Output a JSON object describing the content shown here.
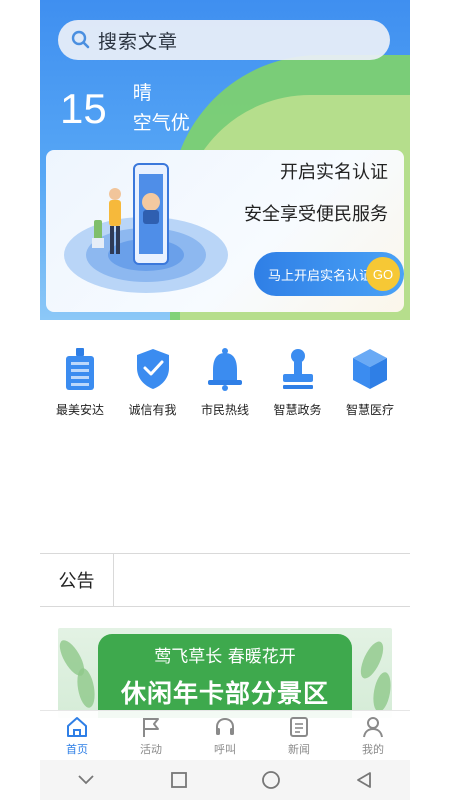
{
  "search": {
    "placeholder": "搜索文章"
  },
  "weather": {
    "temperature": "15",
    "condition": "晴",
    "air_quality": "空气优"
  },
  "verify_card": {
    "line1": "开启实名认证",
    "line2": "安全享受便民服务",
    "button_label": "马上开启实名认证",
    "go_label": "GO"
  },
  "quick_menu": [
    {
      "label": "最美安达",
      "icon": "building-icon"
    },
    {
      "label": "诚信有我",
      "icon": "shield-check-icon"
    },
    {
      "label": "市民热线",
      "icon": "bell-icon"
    },
    {
      "label": "智慧政务",
      "icon": "stamp-icon"
    },
    {
      "label": "智慧医疗",
      "icon": "cube-icon"
    }
  ],
  "notice": {
    "label": "公告"
  },
  "banner": {
    "subtitle": "莺飞草长 春暖花开",
    "title": "休闲年卡部分景区"
  },
  "tabbar": [
    {
      "label": "首页",
      "icon": "home-icon",
      "active": true
    },
    {
      "label": "活动",
      "icon": "flag-icon",
      "active": false
    },
    {
      "label": "呼叫",
      "icon": "headset-icon",
      "active": false
    },
    {
      "label": "新闻",
      "icon": "news-icon",
      "active": false
    },
    {
      "label": "我的",
      "icon": "user-icon",
      "active": false
    }
  ],
  "colors": {
    "accent": "#2f7fe6",
    "go": "#f6c835",
    "banner_green": "#3ea94d"
  }
}
